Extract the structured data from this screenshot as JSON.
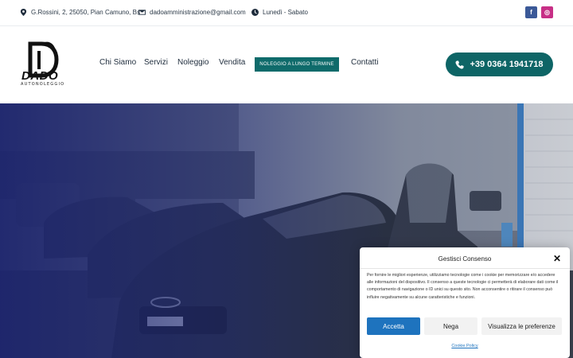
{
  "topbar": {
    "address": "G.Rossini, 2, 25050, Pian Camuno, Bs",
    "email": "dadoamministrazione@gmail.com",
    "hours": "Lunedì - Sabato",
    "facebook_glyph": "f",
    "instagram_glyph": "◎"
  },
  "brand": {
    "name": "DADO",
    "tagline": "AUTONOLEGGIO"
  },
  "nav": {
    "items": [
      "Chi Siamo",
      "Servizi",
      "Noleggio",
      "Vendita"
    ],
    "cta": "NOLEGGIO A LUNGO TERMINE",
    "contact": "Contatti"
  },
  "phone": {
    "label": "+39 0364 1941718"
  },
  "cookie": {
    "title": "Gestisci Consenso",
    "text": "Per fornire le migliori esperienze, utilizziamo tecnologie come i cookie per memorizzare e/o accedere alle informazioni del dispositivo. Il consenso a queste tecnologie ci permetterà di elaborare dati come il comportamento di navigazione o ID unici su questo sito. Non acconsentire o ritirare il consenso può influire negativamente su alcune caratteristiche e funzioni.",
    "accept": "Accetta",
    "deny": "Nega",
    "preferences": "Visualizza le preferenze",
    "policy_link": "Cookie Policy",
    "close_glyph": "✕"
  },
  "colors": {
    "primary": "#0e6566",
    "accept": "#1e73be",
    "overlay": "#1c246e"
  }
}
